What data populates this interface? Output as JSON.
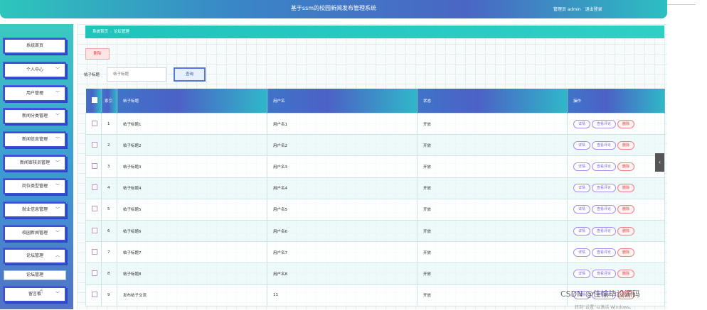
{
  "header": {
    "title": "基于ssm的校园新闻发布管理系统",
    "user_label": "管理员 admin",
    "logout": "退出登录"
  },
  "sidebar": {
    "items": [
      {
        "label": "系统首页",
        "chevron": false
      },
      {
        "label": "个人中心",
        "chevron": true
      },
      {
        "label": "用户管理",
        "chevron": true
      },
      {
        "label": "新闻分类管理",
        "chevron": true
      },
      {
        "label": "新闻信息管理",
        "chevron": true
      },
      {
        "label": "新闻审核员管理",
        "chevron": true
      },
      {
        "label": "岗位类型管理",
        "chevron": true
      },
      {
        "label": "就业信息管理",
        "chevron": true
      },
      {
        "label": "校园新闻管理",
        "chevron": true
      },
      {
        "label": "论坛管理",
        "chevron": true,
        "expanded": true
      },
      {
        "label": "留言板",
        "chevron": true
      }
    ],
    "submenu": "论坛管理"
  },
  "breadcrumb": {
    "home": "系统首页",
    "separator": ":",
    "current": "论坛管理"
  },
  "toolbar": {
    "delete_label": "删除",
    "search_label": "帖子标题",
    "search_placeholder": "帖子标题",
    "search_button": "查询"
  },
  "table": {
    "columns": [
      "索引",
      "帖子标题",
      "用户名",
      "状态",
      "操作"
    ],
    "rows": [
      {
        "index": "1",
        "title": "帖子标题1",
        "username": "用户名1",
        "status": "开放"
      },
      {
        "index": "2",
        "title": "帖子标题2",
        "username": "用户名2",
        "status": "开放"
      },
      {
        "index": "3",
        "title": "帖子标题3",
        "username": "用户名3",
        "status": "开放"
      },
      {
        "index": "4",
        "title": "帖子标题4",
        "username": "用户名4",
        "status": "开放"
      },
      {
        "index": "5",
        "title": "帖子标题5",
        "username": "用户名5",
        "status": "开放"
      },
      {
        "index": "6",
        "title": "帖子标题6",
        "username": "用户名6",
        "status": "开放"
      },
      {
        "index": "7",
        "title": "帖子标题7",
        "username": "用户名7",
        "status": "开放"
      },
      {
        "index": "8",
        "title": "帖子标题8",
        "username": "用户名8",
        "status": "开放"
      },
      {
        "index": "9",
        "title": "发布帖子交流",
        "username": "11",
        "status": "开放"
      }
    ],
    "actions": {
      "detail": "详情",
      "comments": "查看评论",
      "delete": "删除"
    }
  },
  "overlay": {
    "watermark": "CSDN @佳愉毕设源码",
    "activate": "转到“设置”以激活 Windows。"
  },
  "colors": {
    "accent": "#1fc4ba",
    "header_blue": "#4a66c4",
    "danger": "#e04848",
    "action_purple": "#7766dd"
  }
}
